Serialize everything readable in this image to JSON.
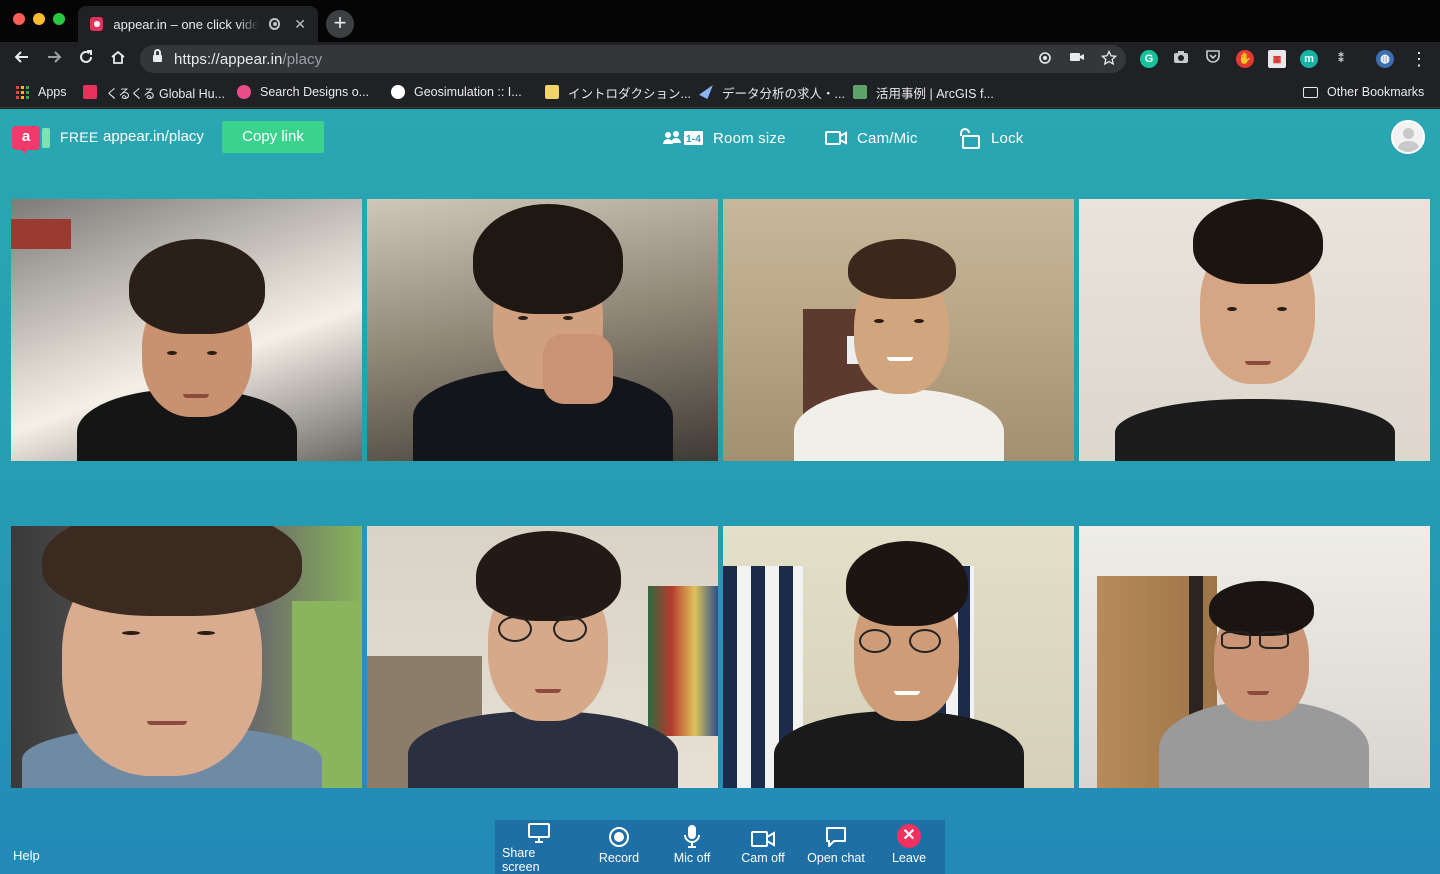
{
  "browser": {
    "tab_title": "appear.in – one click video",
    "tab_close": "✕",
    "new_tab": "+",
    "url_host": "https://appear.in",
    "url_path": "/placy",
    "bookmarks": [
      {
        "label": "Apps"
      },
      {
        "label": "くるくる Global Hu...",
        "icon_color": "#e6325b"
      },
      {
        "label": "Search Designs o...",
        "icon_color": "#ea4c89"
      },
      {
        "label": "Geosimulation :: I...",
        "icon_color": "#ffffff"
      },
      {
        "label": "イントロダクション...",
        "icon_color": "#f5d36b"
      },
      {
        "label": "データ分析の求人・...",
        "icon_color": "#8ab4f8"
      },
      {
        "label": "活用事例 | ArcGIS f...",
        "icon_color": "#5aa469"
      },
      {
        "label": "Other Bookmarks"
      }
    ]
  },
  "app": {
    "plan": "FREE",
    "room_url": "appear.in/placy",
    "copy_link": "Copy link",
    "room_size_badge": "1-4",
    "room_size": "Room size",
    "cam_mic": "Cam/Mic",
    "lock": "Lock",
    "help": "Help",
    "controls": {
      "share_screen": "Share screen",
      "record": "Record",
      "mic_off": "Mic off",
      "cam_off": "Cam off",
      "open_chat": "Open chat",
      "leave": "Leave"
    },
    "colors": {
      "background": "#26a0b2",
      "copy_button": "#3ad28d",
      "controls_bar": "#1e6fa5",
      "leave": "#f0305f",
      "logo_pink": "#f03a6b",
      "logo_teal": "#7ce2b4"
    }
  }
}
